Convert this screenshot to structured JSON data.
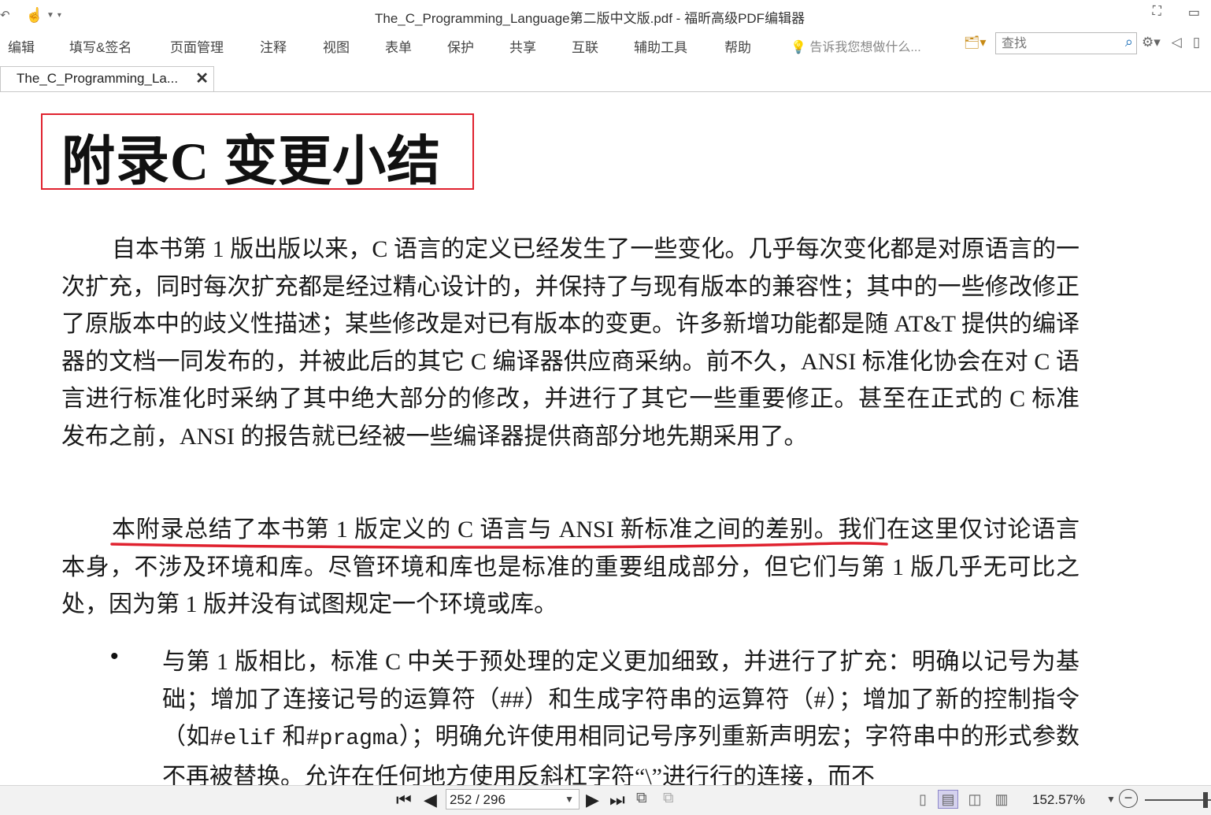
{
  "titlebar": {
    "title": "The_C_Programming_Language第二版中文版.pdf - 福昕高级PDF编辑器"
  },
  "menu": {
    "items": [
      "编辑",
      "填写&签名",
      "页面管理",
      "注释",
      "视图",
      "表单",
      "保护",
      "共享",
      "互联",
      "辅助工具",
      "帮助"
    ],
    "tell_me": "告诉我您想做什么...",
    "search_placeholder": "查找"
  },
  "tab": {
    "label": "The_C_Programming_La...",
    "close": "✕"
  },
  "document": {
    "heading": "附录C 变更小结",
    "para1": "自本书第 1 版出版以来，C 语言的定义已经发生了一些变化。几乎每次变化都是对原语言的一次扩充，同时每次扩充都是经过精心设计的，并保持了与现有版本的兼容性；其中的一些修改修正了原版本中的歧义性描述；某些修改是对已有版本的变更。许多新增功能都是随 AT&T 提供的编译器的文档一同发布的，并被此后的其它 C 编译器供应商采纳。前不久，ANSI 标准化协会在对 C 语言进行标准化时采纳了其中绝大部分的修改，并进行了其它一些重要修正。甚至在正式的 C 标准发布之前，ANSI 的报告就已经被一些编译器提供商部分地先期采用了。",
    "para2_underlined": "本附录总结了本书第 1 版定义的 C 语言与 ANSI 新标准之间的差别。",
    "para2_rest": "我们在这里仅讨论语言本身，不涉及环境和库。尽管环境和库也是标准的重要组成部分，但它们与第 1 版几乎无可比之处，因为第 1 版并没有试图规定一个环境或库。",
    "bullet_marker": "•",
    "bullet1_a": "与第 1 版相比，标准 C 中关于预处理的定义更加细致，并进行了扩充：明确以记号为基础；增加了连接记号的运算符（##）和生成字符串的运算符（#）；增加了新的控制指令（如",
    "bullet1_code1": "#elif",
    "bullet1_b": " 和",
    "bullet1_code2": "#pragma",
    "bullet1_c": "）；明确允许使用相同记号序列重新声明宏；字符串中的形式参数不再被替换。允许在任何地方使用反斜杠字符“\\”进行行的连接，而不"
  },
  "status": {
    "page_value": "252 / 296",
    "zoom": "152.57%"
  },
  "colors": {
    "highlight_box": "#e0222f",
    "underline": "#e0222f",
    "active_view": "#d5d2ee"
  },
  "icons": {
    "hand_tool": "hand-icon",
    "search": "magnifier-icon",
    "settings": "gear-icon"
  }
}
